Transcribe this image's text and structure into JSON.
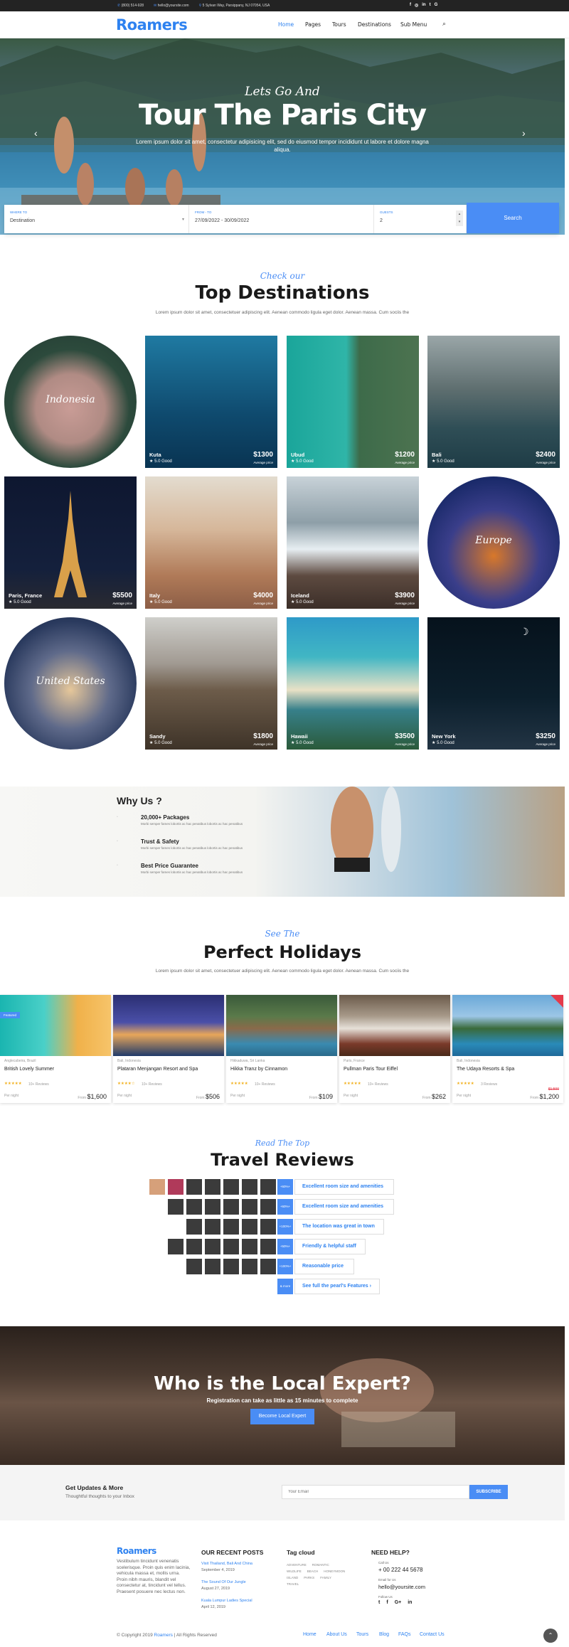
{
  "topbar": {
    "phone": "(800) 514-928",
    "email": "hello@yoursite.com",
    "address": "5 Sylvan Way, Parsippany, NJ 07054, USA",
    "social_icons": [
      "facebook-icon",
      "instagram-icon",
      "linkedin-icon",
      "twitter-icon",
      "google-icon"
    ]
  },
  "header": {
    "logo": "Roamers",
    "nav": [
      "Home",
      "Pages",
      "Tours",
      "Destinations",
      "Sub Menu"
    ],
    "active_nav": "Home",
    "accent": "#2e82f0"
  },
  "hero": {
    "script": "Lets Go And",
    "title": "Tour The Paris City",
    "subtitle": "Lorem ipsum dolor sit amet, consectetur adipisicing elit, sed do eiusmod tempor incididunt ut labore et dolore magna aliqua."
  },
  "search": {
    "where_label": "WHERE TO",
    "where_value": "Destination",
    "dates_label": "FROM - TO",
    "dates_value": "27/09/2022 - 30/09/2022",
    "guests_label": "GUESTS",
    "guests_value": "2",
    "button": "Search"
  },
  "destinations": {
    "script": "Check our",
    "title": "Top Destinations",
    "lead": "Lorem ipsum dolor sit amet, consectetuer adipiscing elit. Aenean commodo ligula eget dolor. Aenean massa. Cum sociis the",
    "items": [
      {
        "name": "Indonesia",
        "shape": "circle"
      },
      {
        "name": "Kuta",
        "rating": "5.0 Good",
        "price": "$1300",
        "avg": "Average price"
      },
      {
        "name": "Ubud",
        "rating": "5.0 Good",
        "price": "$1200",
        "avg": "Average price"
      },
      {
        "name": "Bali",
        "rating": "5.0 Good",
        "price": "$2400",
        "avg": "Average price"
      },
      {
        "name": "Paris, France",
        "rating": "5.0 Good",
        "price": "$5500",
        "avg": "Average price"
      },
      {
        "name": "Italy",
        "rating": "5.0 Good",
        "price": "$4000",
        "avg": "Average price"
      },
      {
        "name": "Iceland",
        "rating": "5.0 Good",
        "price": "$3900",
        "avg": "Average price"
      },
      {
        "name": "Europe",
        "shape": "circle"
      },
      {
        "name": "United States",
        "shape": "circle"
      },
      {
        "name": "Sandy",
        "rating": "5.0 Good",
        "price": "$1800",
        "avg": "Average price"
      },
      {
        "name": "Hawaii",
        "rating": "5.0 Good",
        "price": "$3500",
        "avg": "Average price"
      },
      {
        "name": "New York",
        "rating": "5.0 Good",
        "price": "$3250",
        "avg": "Average price"
      }
    ]
  },
  "why": {
    "title": "Why Us ?",
    "items": [
      {
        "title": "20,000+ Packages",
        "text": "Morbi semper fames lobortis ac hac penatibus lobortis ac hac penatibus"
      },
      {
        "title": "Trust & Safety",
        "text": "Morbi semper fames lobortis ac hac penatibus lobortis ac hac penatibus"
      },
      {
        "title": "Best Price Guarantee",
        "text": "Morbi semper fames lobortis ac hac penatibus lobortis ac hac penatibus"
      }
    ]
  },
  "holidays": {
    "script": "See The",
    "title": "Perfect Holidays",
    "lead": "Lorem ipsum dolor sit amet, consectetuer adipiscing elit. Aenean commodo ligula eget dolor. Aenean massa. Cum sociis the",
    "featured": "Featured",
    "cards": [
      {
        "loc": "Anglecabeira, Brazil",
        "title": "British Lovely Summer",
        "stars": "★★★★★",
        "reviews": "10+ Reviews",
        "per": "Per night",
        "from": "From",
        "price": "$1,600"
      },
      {
        "loc": "Bali, Indonesia",
        "title": "Plataran Menjangan Resort and Spa",
        "stars": "★★★★☆",
        "reviews": "10+ Reviews",
        "per": "Per night",
        "from": "From",
        "price": "$506"
      },
      {
        "loc": "Hikkaduwa, Sri Lanka",
        "title": "Hikka Tranz by Cinnamon",
        "stars": "★★★★★",
        "reviews": "10+ Reviews",
        "per": "Per night",
        "from": "From",
        "price": "$109"
      },
      {
        "loc": "Paris, France",
        "title": "Pullman Paris Tour Eiffel",
        "stars": "★★★★★",
        "reviews": "10+ Reviews",
        "per": "Per night",
        "from": "From",
        "price": "$262"
      },
      {
        "loc": "Bali, Indonesia",
        "title": "The Udaya Resorts & Spa",
        "stars": "★★★★★",
        "reviews": "3 Reviews",
        "per": "Per night",
        "from": "From",
        "old_price": "$1,500",
        "price": "$1,200"
      }
    ]
  },
  "reviews": {
    "script": "Read The Top",
    "title": "Travel Reviews",
    "rows": [
      {
        "tag": "+60%+",
        "text": "Excellent room size and amenities"
      },
      {
        "tag": "+60%+",
        "text": "Excellent room size and amenities"
      },
      {
        "tag": "+100%+",
        "text": "The location was great in town"
      },
      {
        "tag": "+50%+",
        "text": "Friendly & helpful staff"
      },
      {
        "tag": "+100%+",
        "text": "Reasonable price"
      },
      {
        "tag": "& more",
        "text": "See full the pearl's Features ›"
      }
    ]
  },
  "expert": {
    "title": "Who is the Local Expert?",
    "subtitle": "Registration can take as little as 15 minutes to complete",
    "button": "Become Local Expert"
  },
  "newsletter": {
    "title": "Get Updates & More",
    "subtitle": "Thoughtful thoughts to your Inbox",
    "placeholder": "Your Email",
    "button": "SUBSCRIBE"
  },
  "footer": {
    "logo": "Roamers",
    "about": "Vestibulum tincidunt venenatis scelerisque. Proin quis enim lacinia, vehicula massa et, mollis urna. Proin nibh mauris, blandit vel consectetur at, tincidunt vel tellus. Praesent posuere nec lectus non.",
    "posts_title": "OUR RECENT POSTS",
    "posts": [
      {
        "title": "Visit Thailand, Bali And China",
        "date": "September 4, 2019"
      },
      {
        "title": "The Sound Of Our Jungle",
        "date": "August 27, 2019"
      },
      {
        "title": "Kuala Lumpur Ladies Special",
        "date": "April 12, 2019"
      }
    ],
    "tags_title": "Tag cloud",
    "tags": [
      "ADVENTURE",
      "ROMANTIC",
      "WILDLIFE",
      "BEACH",
      "HONEYMOON",
      "ISLAND",
      "PARKS",
      "FAMILY",
      "TRAVEL"
    ],
    "help_title": "NEED HELP?",
    "call_label": "Call Us",
    "phone": "+ 00 222 44 5678",
    "email_label": "Email for Us",
    "email": "hello@yoursite.com",
    "follow_label": "Follow Us",
    "copyright": "© Copyright 2019",
    "copyright_brand": "Roamers",
    "rights": "All Rights Reserved",
    "links": [
      "Home",
      "About Us",
      "Tours",
      "Blog",
      "FAQs",
      "Contact Us"
    ]
  }
}
